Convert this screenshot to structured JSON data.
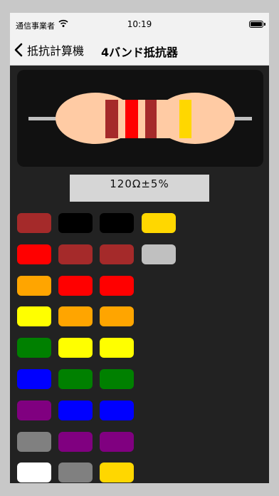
{
  "status_bar": {
    "carrier": "通信事業者",
    "time": "10:19"
  },
  "nav": {
    "back_label": "抵抗計算機",
    "title": "4バンド抵抗器"
  },
  "resistor": {
    "band_colors": [
      "#a52a2a",
      "#ff0000",
      "#a52a2a",
      "#ffd700"
    ],
    "body_color": "#ffcba4",
    "lead_color": "#c0c0c0"
  },
  "value_display": "120Ω±5%",
  "columns": [
    {
      "name": "band-1",
      "colors": [
        "#a52a2a",
        "#ff0000",
        "#ffa500",
        "#ffff00",
        "#008000",
        "#0000ff",
        "#800080",
        "#808080",
        "#ffffff"
      ]
    },
    {
      "name": "band-2",
      "colors": [
        "#000000",
        "#a52a2a",
        "#ff0000",
        "#ffa500",
        "#ffff00",
        "#008000",
        "#0000ff",
        "#800080",
        "#808080"
      ]
    },
    {
      "name": "multiplier",
      "colors": [
        "#000000",
        "#a52a2a",
        "#ff0000",
        "#ffa500",
        "#ffff00",
        "#008000",
        "#0000ff",
        "#800080",
        "#ffd700"
      ]
    },
    {
      "name": "tolerance",
      "colors": [
        "#ffd700",
        "#c0c0c0"
      ]
    }
  ]
}
